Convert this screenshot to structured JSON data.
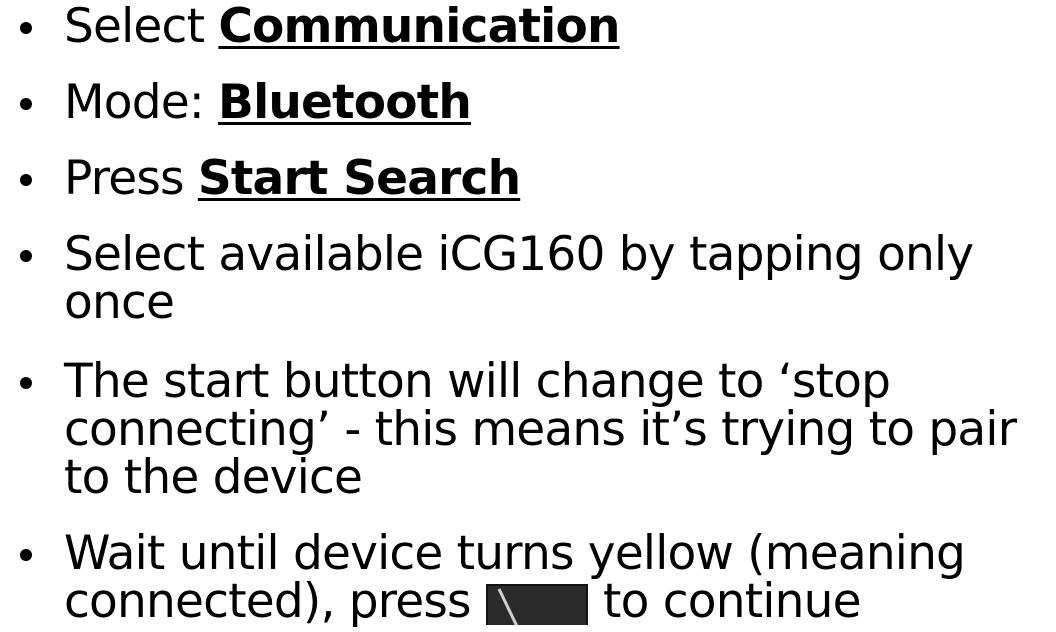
{
  "bullets": [
    {
      "prefix": "Select ",
      "emphasis": "Communication"
    },
    {
      "prefix": "Mode: ",
      "emphasis": "Bluetooth"
    },
    {
      "prefix": "Press ",
      "emphasis": "Start Search"
    },
    {
      "line1": "Select available iCG160 by tapping only",
      "line2": "once"
    },
    {
      "line1": "The start button will change to ‘stop",
      "line2": "connecting’ - this means it’s trying to pair",
      "line3": "to the device"
    },
    {
      "line1": "Wait until device turns yellow (meaning",
      "line2_before": "connected), press ",
      "line2_after": " to continue",
      "icon": "continue-button-icon"
    }
  ],
  "colors": {
    "text": "#000000",
    "icon_background": "#2b2b2b",
    "icon_accent": "#f5d40a"
  }
}
